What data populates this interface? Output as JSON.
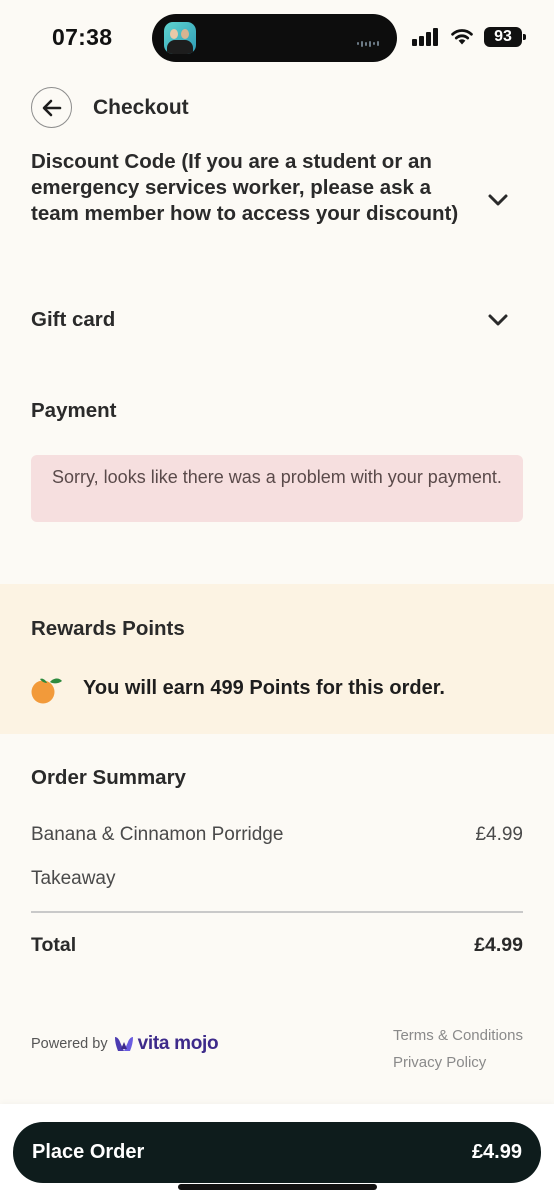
{
  "status_bar": {
    "time": "07:38",
    "battery": "93",
    "icons": [
      "signal-icon",
      "wifi-icon",
      "battery-icon"
    ]
  },
  "header": {
    "title": "Checkout",
    "back_icon": "arrow-left-icon"
  },
  "discount": {
    "label": "Discount Code (If you are a student or an emergency services worker, please ask a team member how to access your discount)",
    "icon": "chevron-down-icon"
  },
  "gift_card": {
    "label": "Gift card",
    "icon": "chevron-down-icon"
  },
  "payment": {
    "heading": "Payment",
    "error": "Sorry, looks like there was a problem with your payment."
  },
  "rewards": {
    "heading": "Rewards Points",
    "message": "You will earn 499 Points for this order.",
    "icon": "orange-icon"
  },
  "order_summary": {
    "heading": "Order Summary",
    "items": [
      {
        "name": "Banana & Cinnamon Porridge",
        "price": "£4.99"
      },
      {
        "name": "Takeaway",
        "price": ""
      }
    ],
    "total_label": "Total",
    "total_value": "£4.99"
  },
  "footer": {
    "powered_by": "Powered by",
    "brand": "vita mojo",
    "links": [
      "Terms & Conditions",
      "Privacy Policy"
    ]
  },
  "place_order": {
    "label": "Place Order",
    "price": "£4.99"
  },
  "colors": {
    "background": "#fcfaf5",
    "rewards_background": "#fcf3e3",
    "error_background": "#f6dfdf",
    "button": "#0e1c1c",
    "brand": "#3d2a8a"
  }
}
